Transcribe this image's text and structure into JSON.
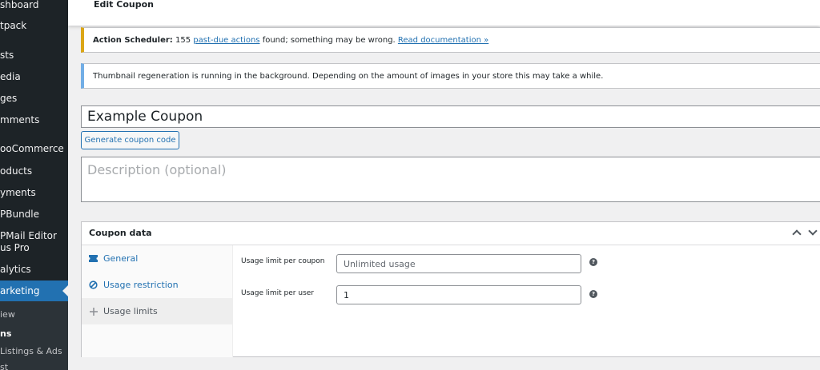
{
  "sidebar": {
    "items": [
      {
        "label": "shboard"
      },
      {
        "label": "tpack"
      },
      {
        "label": "sts"
      },
      {
        "label": "edia"
      },
      {
        "label": "ges"
      },
      {
        "label": "mments"
      },
      {
        "label": "ooCommerce"
      },
      {
        "label": "oducts"
      },
      {
        "label": "yments"
      },
      {
        "label": "PBundle"
      },
      {
        "label": "PMail Editor"
      },
      {
        "label": "us Pro"
      },
      {
        "label": "alytics"
      },
      {
        "label": "arketing"
      }
    ],
    "submenu": [
      {
        "label": "iew"
      },
      {
        "label": "ns"
      },
      {
        "label": "Listings & Ads"
      },
      {
        "label": "st"
      }
    ]
  },
  "header": {
    "title": "Edit Coupon"
  },
  "notices": {
    "warning": {
      "bold": "Action Scheduler:",
      "count": "155",
      "link1": "past-due actions",
      "mid": "found; something may be wrong.",
      "link2": "Read documentation »"
    },
    "info": {
      "text": "Thumbnail regeneration is running in the background. Depending on the amount of images in your store this may take a while."
    }
  },
  "coupon": {
    "title_value": "Example Coupon",
    "generate_label": "Generate coupon code",
    "description_placeholder": "Description (optional)"
  },
  "panel": {
    "title": "Coupon data",
    "tabs": [
      {
        "label": "General"
      },
      {
        "label": "Usage restriction"
      },
      {
        "label": "Usage limits"
      }
    ],
    "fields": [
      {
        "label": "Usage limit per coupon",
        "value": "Unlimited usage"
      },
      {
        "label": "Usage limit per user",
        "value": "1"
      }
    ]
  },
  "colors": {
    "sidebar_bg": "#1d2327",
    "accent": "#2271b1",
    "warning_border": "#dba617",
    "info_border": "#72aee6"
  }
}
